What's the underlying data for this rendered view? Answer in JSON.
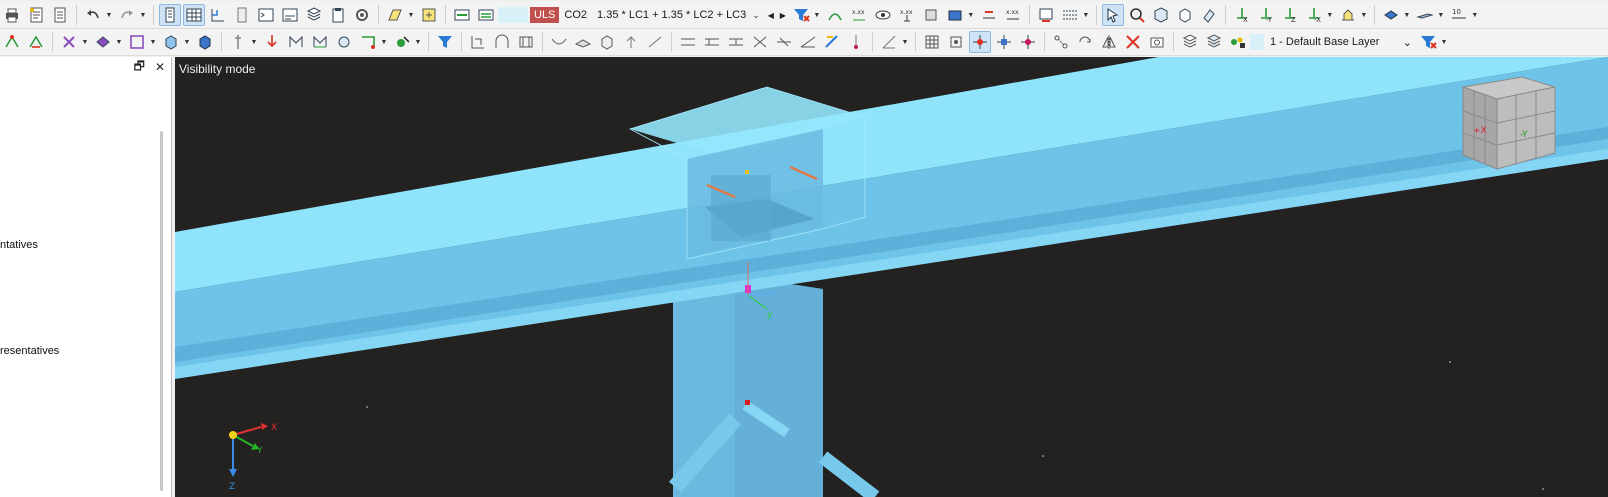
{
  "toolbar": {
    "load_combo": {
      "type_badge": "ULS",
      "name": "CO2",
      "formula": "1.35 * LC1 + 1.35 * LC2 + LC3"
    },
    "layer": {
      "label": "1 - Default Base Layer"
    },
    "zoom_label": "10"
  },
  "panel": {
    "item_1": "ntatives",
    "item_2": "resentatives"
  },
  "viewport": {
    "mode_label": "Visibility mode",
    "colors": {
      "background": "#232221",
      "member": "#8ee3f8",
      "member_shade": "#6db8dc"
    },
    "axes_global": {
      "x": "X",
      "y": "Y",
      "z": "Z"
    },
    "axes_local": {
      "y": "y"
    },
    "view_cube": {
      "x_face": "+X",
      "y_face": "-Y"
    }
  }
}
